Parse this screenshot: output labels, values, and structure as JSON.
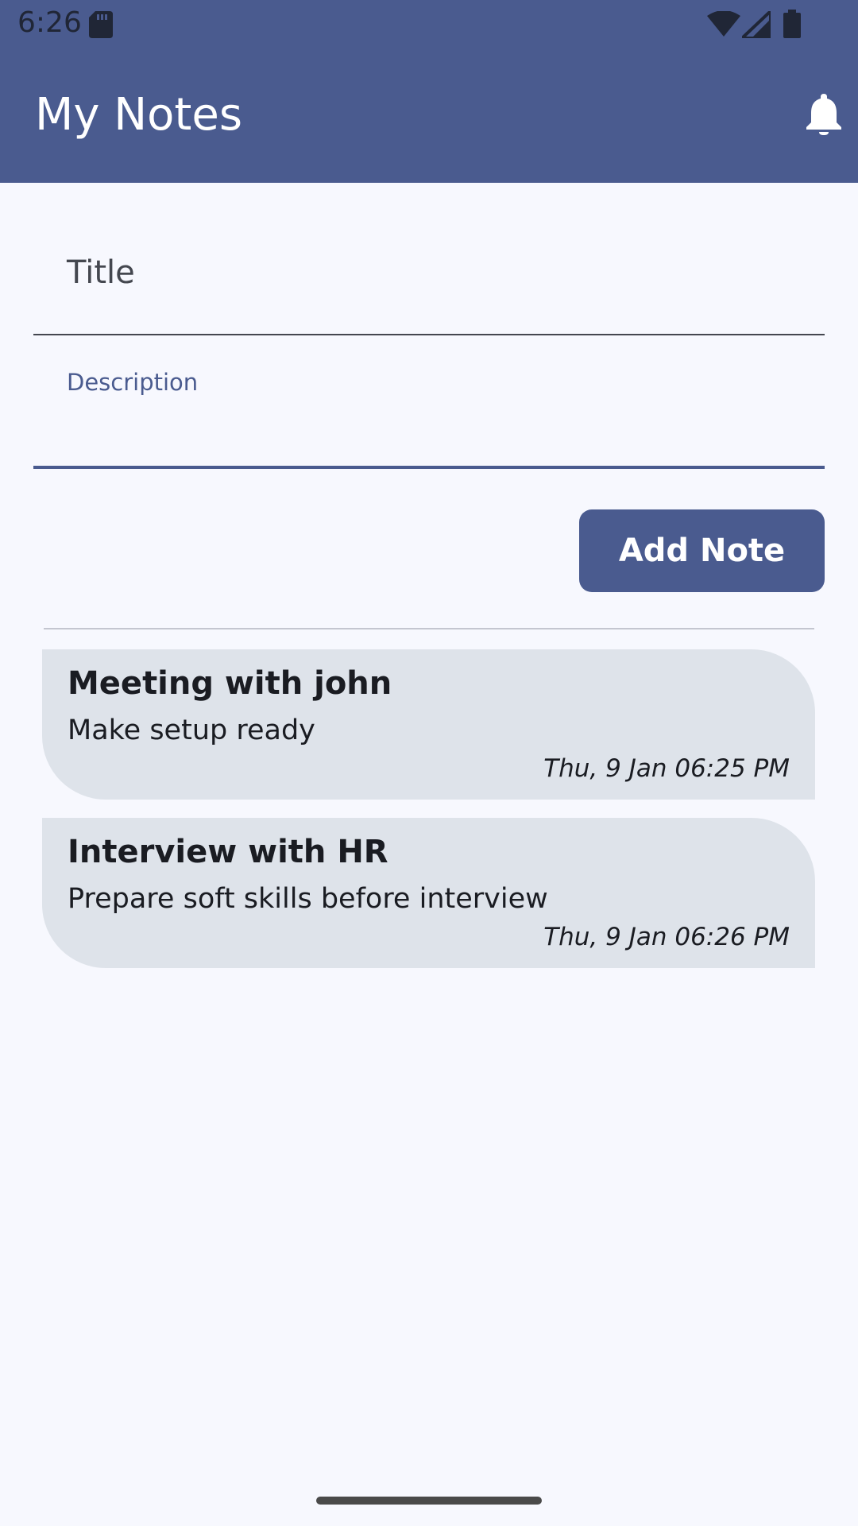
{
  "status_bar": {
    "time": "6:26"
  },
  "app_bar": {
    "title": "My Notes",
    "icon": "bell-icon"
  },
  "form": {
    "title_placeholder": "Title",
    "description_label": "Description",
    "add_button_label": "Add Note"
  },
  "notes": [
    {
      "title": "Meeting with john",
      "description": "Make setup ready",
      "timestamp": "Thu, 9 Jan 06:25 PM"
    },
    {
      "title": "Interview with HR",
      "description": "Prepare soft skills before interview",
      "timestamp": "Thu, 9 Jan 06:26 PM"
    }
  ],
  "colors": {
    "primary": "#4a5b8f",
    "background": "#f7f8fe",
    "card": "#dee3ea",
    "text": "#1a1c22"
  }
}
